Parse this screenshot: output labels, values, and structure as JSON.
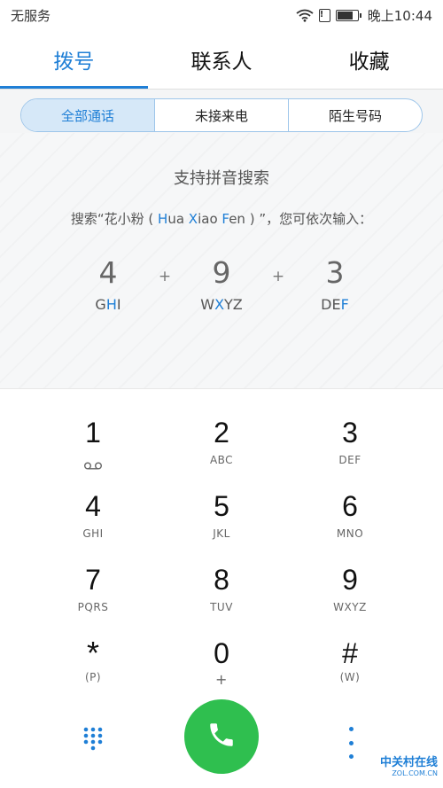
{
  "status_bar": {
    "carrier": "无服务",
    "time": "晚上10:44",
    "icons": [
      "wifi-icon",
      "alert-icon",
      "battery-icon"
    ],
    "alert_symbol": "!"
  },
  "tabs": [
    {
      "label": "拨号",
      "active": true
    },
    {
      "label": "联系人",
      "active": false
    },
    {
      "label": "收藏",
      "active": false
    }
  ],
  "filter": [
    {
      "label": "全部通话",
      "active": true
    },
    {
      "label": "未接来电",
      "active": false
    },
    {
      "label": "陌生号码",
      "active": false
    }
  ],
  "hint": {
    "title": "支持拼音搜索",
    "desc_prefix": "搜索“花小粉 ( ",
    "name_parts": [
      {
        "h": "H",
        "r": "ua "
      },
      {
        "h": "X",
        "r": "iao "
      },
      {
        "h": "F",
        "r": "en"
      }
    ],
    "desc_suffix": " ) ”，您可依次输入：",
    "examples": [
      {
        "digit": "4",
        "pre": "G",
        "hl": "H",
        "post": "I"
      },
      {
        "digit": "9",
        "pre": "W",
        "hl": "X",
        "post": "YZ"
      },
      {
        "digit": "3",
        "pre": "DE",
        "hl": "F",
        "post": ""
      }
    ],
    "plus": "+"
  },
  "keypad": {
    "keys": [
      {
        "digit": "1",
        "sub": "",
        "icon": "voicemail-icon"
      },
      {
        "digit": "2",
        "sub": "ABC"
      },
      {
        "digit": "3",
        "sub": "DEF"
      },
      {
        "digit": "4",
        "sub": "GHI"
      },
      {
        "digit": "5",
        "sub": "JKL"
      },
      {
        "digit": "6",
        "sub": "MNO"
      },
      {
        "digit": "7",
        "sub": "PQRS"
      },
      {
        "digit": "8",
        "sub": "TUV"
      },
      {
        "digit": "9",
        "sub": "WXYZ"
      },
      {
        "digit": "*",
        "sub": "(P)"
      },
      {
        "digit": "0",
        "sub": "+"
      },
      {
        "digit": "#",
        "sub": "(W)"
      }
    ]
  },
  "bottom": {
    "dialpad_icon": "dialpad-icon",
    "call_icon": "phone-icon",
    "more_icon": "more-vert-icon"
  },
  "watermark": {
    "main": "中关村在线",
    "sub": "ZOL.COM.CN"
  },
  "colors": {
    "accent": "#1f7fd6",
    "call_green": "#2fbf4f"
  }
}
